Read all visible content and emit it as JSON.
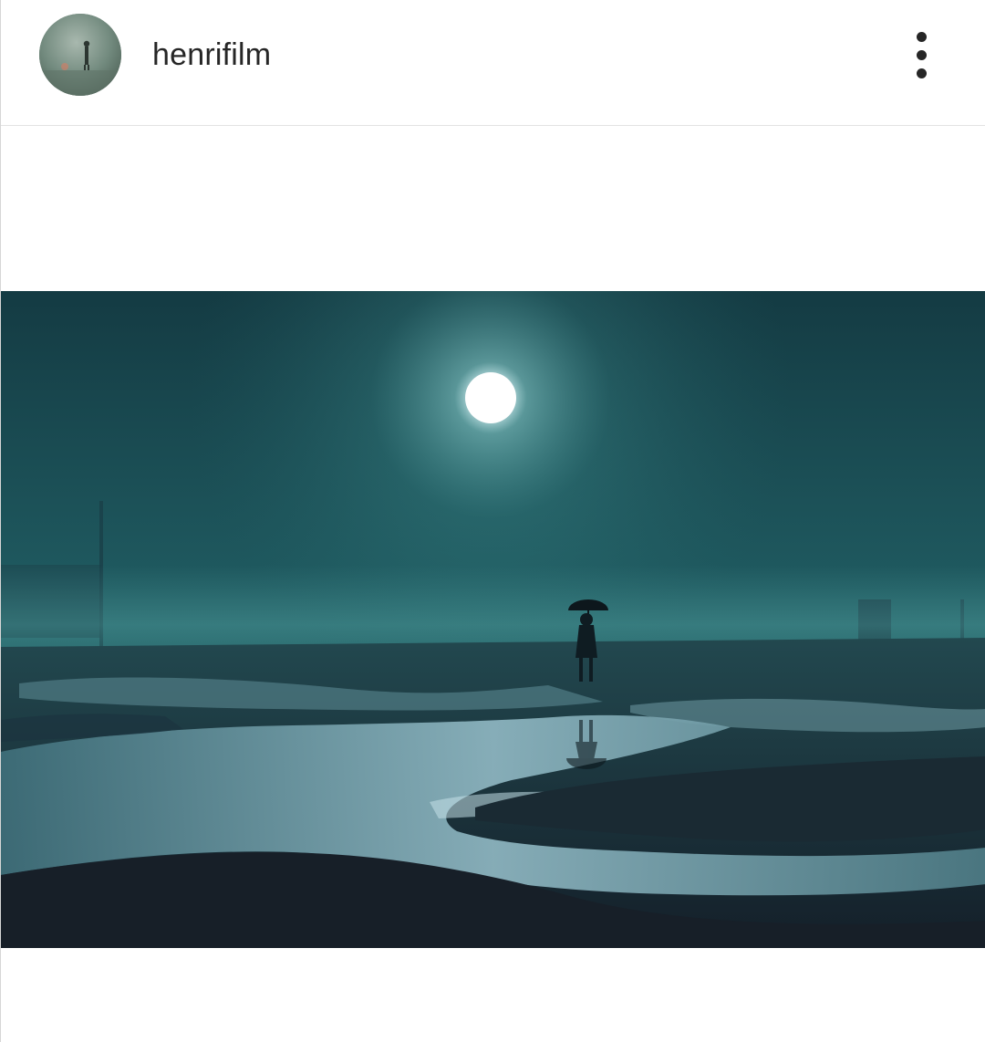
{
  "post": {
    "username": "henrifilm",
    "avatar_icon": "profile-photo",
    "more_icon": "more-options-vertical-icon",
    "image_icon": "foggy-night-umbrella-photo"
  },
  "colors": {
    "text": "#262626",
    "divider": "#e3e3e3",
    "photo_sky": "#1b4a4f",
    "photo_glow": "#e9fbff"
  }
}
